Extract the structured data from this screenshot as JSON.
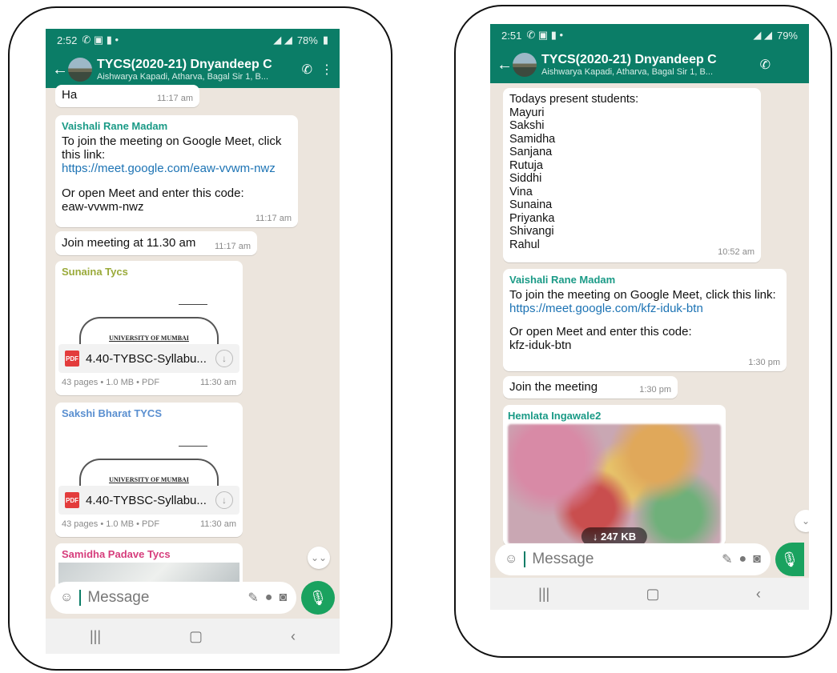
{
  "colors": {
    "header": "#0b7d67",
    "sender_vaishali": "#1a9a86",
    "sender_sunaina": "#9aaa3a",
    "sender_sakshi": "#5a8fd0",
    "sender_samidha": "#d63d7c",
    "sender_hemlata": "#1a9a86"
  },
  "left": {
    "status": {
      "time": "2:52",
      "battery": "78%"
    },
    "header": {
      "title": "TYCS(2020-21) Dnyandeep C",
      "subtitle": "Aishwarya Kapadi, Atharva, Bagal Sir 1, B..."
    },
    "msg_ha": {
      "text": "Ha",
      "time": "11:17 am"
    },
    "msg_meet": {
      "sender": "Vaishali Rane Madam",
      "line1": "To join the meeting on Google Meet, click this link:",
      "link": "https://meet.google.com/eaw-vvwm-nwz",
      "line2": "Or open Meet and enter this code:",
      "code": "eaw-vvwm-nwz",
      "time": "11:17 am"
    },
    "msg_join": {
      "text": "Join meeting at 11.30 am",
      "time": "11:17 am"
    },
    "doc1": {
      "sender": "Sunaina Tycs",
      "univ": "UNIVERSITY OF MUMBAI",
      "pdf": "PDF",
      "name": "4.40-TYBSC-Syllabu...",
      "meta": "43 pages • 1.0 MB • PDF",
      "time": "11:30 am"
    },
    "doc2": {
      "sender": "Sakshi Bharat TYCS",
      "univ": "UNIVERSITY OF MUMBAI",
      "pdf": "PDF",
      "name": "4.40-TYBSC-Syllabu...",
      "meta": "43 pages • 1.0 MB • PDF",
      "time": "11:30 am"
    },
    "doc3": {
      "sender": "Samidha Padave Tycs"
    },
    "input": {
      "placeholder": "Message"
    }
  },
  "right": {
    "status": {
      "time": "2:51",
      "battery": "79%"
    },
    "header": {
      "title": "TYCS(2020-21) Dnyandeep C",
      "subtitle": "Aishwarya Kapadi, Atharva, Bagal Sir 1, B..."
    },
    "msg_list": {
      "heading": "Todays present students:",
      "names": [
        "Mayuri",
        "Sakshi",
        "Samidha",
        "Sanjana",
        "Rutuja",
        "Siddhi",
        "Vina",
        "Sunaina",
        "Priyanka",
        "Shivangi",
        "Rahul"
      ],
      "time": "10:52 am"
    },
    "msg_meet": {
      "sender": "Vaishali Rane Madam",
      "line1": "To join the meeting on Google Meet, click this link:",
      "link": "https://meet.google.com/kfz-iduk-btn",
      "line2": "Or open Meet and enter this code:",
      "code": "kfz-iduk-btn",
      "time": "1:30 pm"
    },
    "msg_join": {
      "text": "Join the meeting",
      "time": "1:30 pm"
    },
    "image_msg": {
      "sender": "Hemlata Ingawale2",
      "size": "247 KB"
    },
    "input": {
      "placeholder": "Message"
    }
  }
}
